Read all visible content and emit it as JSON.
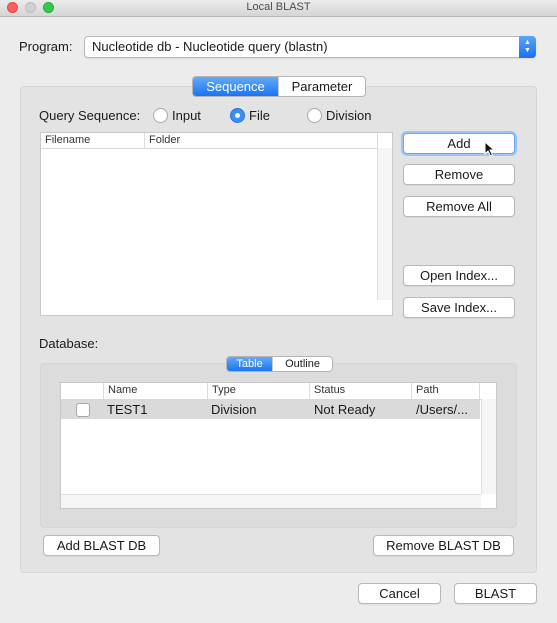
{
  "window": {
    "title": "Local BLAST"
  },
  "program": {
    "label": "Program:",
    "selected": "Nucleotide db - Nucleotide query (blastn)"
  },
  "main_tabs": [
    {
      "label": "Sequence",
      "selected": true
    },
    {
      "label": "Parameter",
      "selected": false
    }
  ],
  "query": {
    "label": "Query Sequence:",
    "options": [
      {
        "label": "Input",
        "selected": false
      },
      {
        "label": "File",
        "selected": true
      },
      {
        "label": "Division",
        "selected": false
      }
    ],
    "columns": [
      "Filename",
      "Folder"
    ],
    "buttons": {
      "add": "Add",
      "remove": "Remove",
      "remove_all": "Remove All",
      "open_index": "Open Index...",
      "save_index": "Save Index..."
    }
  },
  "database": {
    "label": "Database:",
    "view_tabs": [
      {
        "label": "Table",
        "selected": true
      },
      {
        "label": "Outline",
        "selected": false
      }
    ],
    "columns": [
      "Name",
      "Type",
      "Status",
      "Path"
    ],
    "rows": [
      {
        "checked": false,
        "name": "TEST1",
        "type": "Division",
        "status": "Not Ready",
        "path": "/Users/..."
      }
    ],
    "add_button": "Add BLAST DB",
    "remove_button": "Remove BLAST DB"
  },
  "footer": {
    "cancel": "Cancel",
    "blast": "BLAST"
  },
  "colors": {
    "accent": "#1b74f0",
    "close": "#fc605b",
    "zoom": "#34c84a"
  }
}
